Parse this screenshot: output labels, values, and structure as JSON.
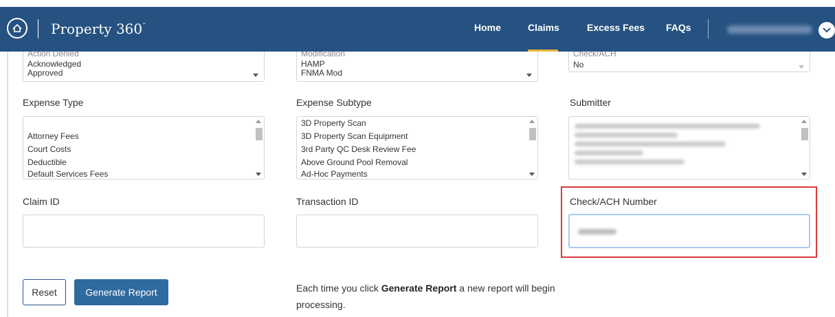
{
  "header": {
    "brand": "Property 360",
    "brand_mark": "˜",
    "nav": [
      "Home",
      "Claims",
      "Excess Fees",
      "FAQs"
    ],
    "active_nav": "Claims",
    "colors": {
      "header_bg": "#265281",
      "active_indicator": "#e8b53a",
      "primary_button": "#2f6aa0",
      "highlight": "#d93a3a"
    }
  },
  "top_selects": {
    "status": {
      "cut_label": "Action Denied",
      "options": [
        "Acknowledged",
        "Approved"
      ]
    },
    "program": {
      "cut_label": "Modification",
      "options": [
        "HAMP",
        "FNMA Mod"
      ]
    },
    "third": {
      "cut_label": "Check/ACH",
      "value": "No"
    }
  },
  "expense_type": {
    "label": "Expense Type",
    "options": [
      "",
      "Attorney Fees",
      "Court Costs",
      "Deductible",
      "Default Services Fees"
    ]
  },
  "expense_subtype": {
    "label": "Expense Subtype",
    "options": [
      "3D Property Scan",
      "3D Property Scan Equipment",
      "3rd Party QC Desk Review Fee",
      "Above Ground Pool Removal",
      "Ad-Hoc Payments"
    ]
  },
  "submitter": {
    "label": "Submitter"
  },
  "claim_id": {
    "label": "Claim ID",
    "value": ""
  },
  "transaction_id": {
    "label": "Transaction ID",
    "value": ""
  },
  "check_ach": {
    "label": "Check/ACH Number"
  },
  "buttons": {
    "reset": "Reset",
    "generate": "Generate Report"
  },
  "note": {
    "prefix": "Each time you click ",
    "bold": "Generate Report",
    "suffix": " a new report will begin processing."
  },
  "icons": {
    "logo": "house-seal-icon",
    "user_menu": "chevron-down-icon"
  }
}
